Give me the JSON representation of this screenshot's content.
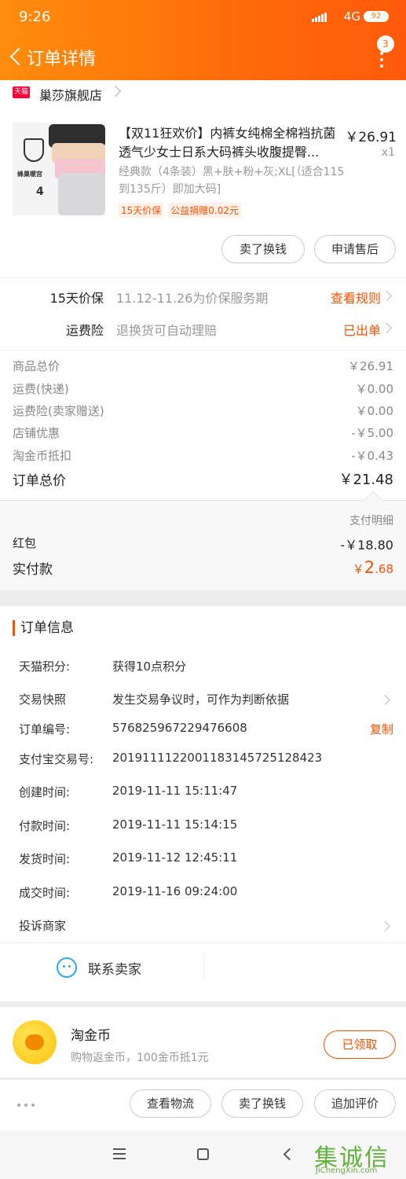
{
  "status_bar": {
    "time": "9:26",
    "network": "4G",
    "battery": "92"
  },
  "header": {
    "title": "订单详情",
    "badge": "3"
  },
  "shop": {
    "tag": "天猫",
    "name": "巢莎旗舰店"
  },
  "product": {
    "title": "【双11狂欢价】内裤女纯棉全棉裆抗菌透气少女士日系大码裤头收腹提臀...",
    "sku": "经典款（4条装）黑+肤+粉+灰;XL[（适合115到135斤）即加大码]",
    "price": "￥26.91",
    "qty": "x1",
    "tags": [
      "15天价保",
      "公益捐赠0.02元"
    ],
    "thumb_brand": "蜂巢暖宫",
    "thumb_count": "4"
  },
  "item_buttons": {
    "sell": "卖了换钱",
    "after_sale": "申请售后"
  },
  "services": [
    {
      "label": "15天价保",
      "value": "11.12-11.26为价保服务期",
      "link": "查看规则"
    },
    {
      "label": "运费险",
      "value": "退换货可自动理赔",
      "link": "已出单"
    }
  ],
  "fees": [
    {
      "label": "商品总价",
      "value": "￥26.91"
    },
    {
      "label": "运费(快递)",
      "value": "￥0.00"
    },
    {
      "label": "运费险(卖家赠送)",
      "value": "￥0.00"
    },
    {
      "label": "店铺优惠",
      "value": "-￥5.00"
    },
    {
      "label": "淘金币抵扣",
      "value": "-￥0.43"
    }
  ],
  "total": {
    "label": "订单总价",
    "value": "￥21.48"
  },
  "payment": {
    "detail_link": "支付明细",
    "red_packet": {
      "label": "红包",
      "value": "-￥18.80"
    },
    "paid": {
      "label": "实付款",
      "currency": "￥",
      "int": "2",
      "dec": ".68"
    }
  },
  "order_info": {
    "heading": "订单信息",
    "rows": [
      {
        "key": "天猫积分:",
        "value": "获得10点积分"
      },
      {
        "key": "交易快照",
        "value": "发生交易争议时，可作为判断依据"
      },
      {
        "key": "订单编号:",
        "value": "576825967229476608",
        "action": "复制"
      },
      {
        "key": "支付宝交易号:",
        "value": "2019111122001183145725128423"
      },
      {
        "key": "创建时间:",
        "value": "2019-11-11 15:11:47"
      },
      {
        "key": "付款时间:",
        "value": "2019-11-11 15:14:15"
      },
      {
        "key": "发货时间:",
        "value": "2019-11-12 12:45:11"
      },
      {
        "key": "成交时间:",
        "value": "2019-11-16 09:24:00"
      },
      {
        "key": "投诉商家",
        "value": ""
      }
    ],
    "contact": "联系卖家"
  },
  "coin": {
    "title": "淘金币",
    "desc": "购物返金币，100金币抵1元",
    "button": "已领取"
  },
  "actions": {
    "logistics": "查看物流",
    "sell": "卖了换钱",
    "review": "追加评价"
  },
  "watermark": {
    "logo": "集诚信",
    "url": "JiChengXin.com"
  },
  "colors": {
    "accent": "#ff5000",
    "header": "#ff7a0a",
    "chat": "#2eaaf1"
  }
}
